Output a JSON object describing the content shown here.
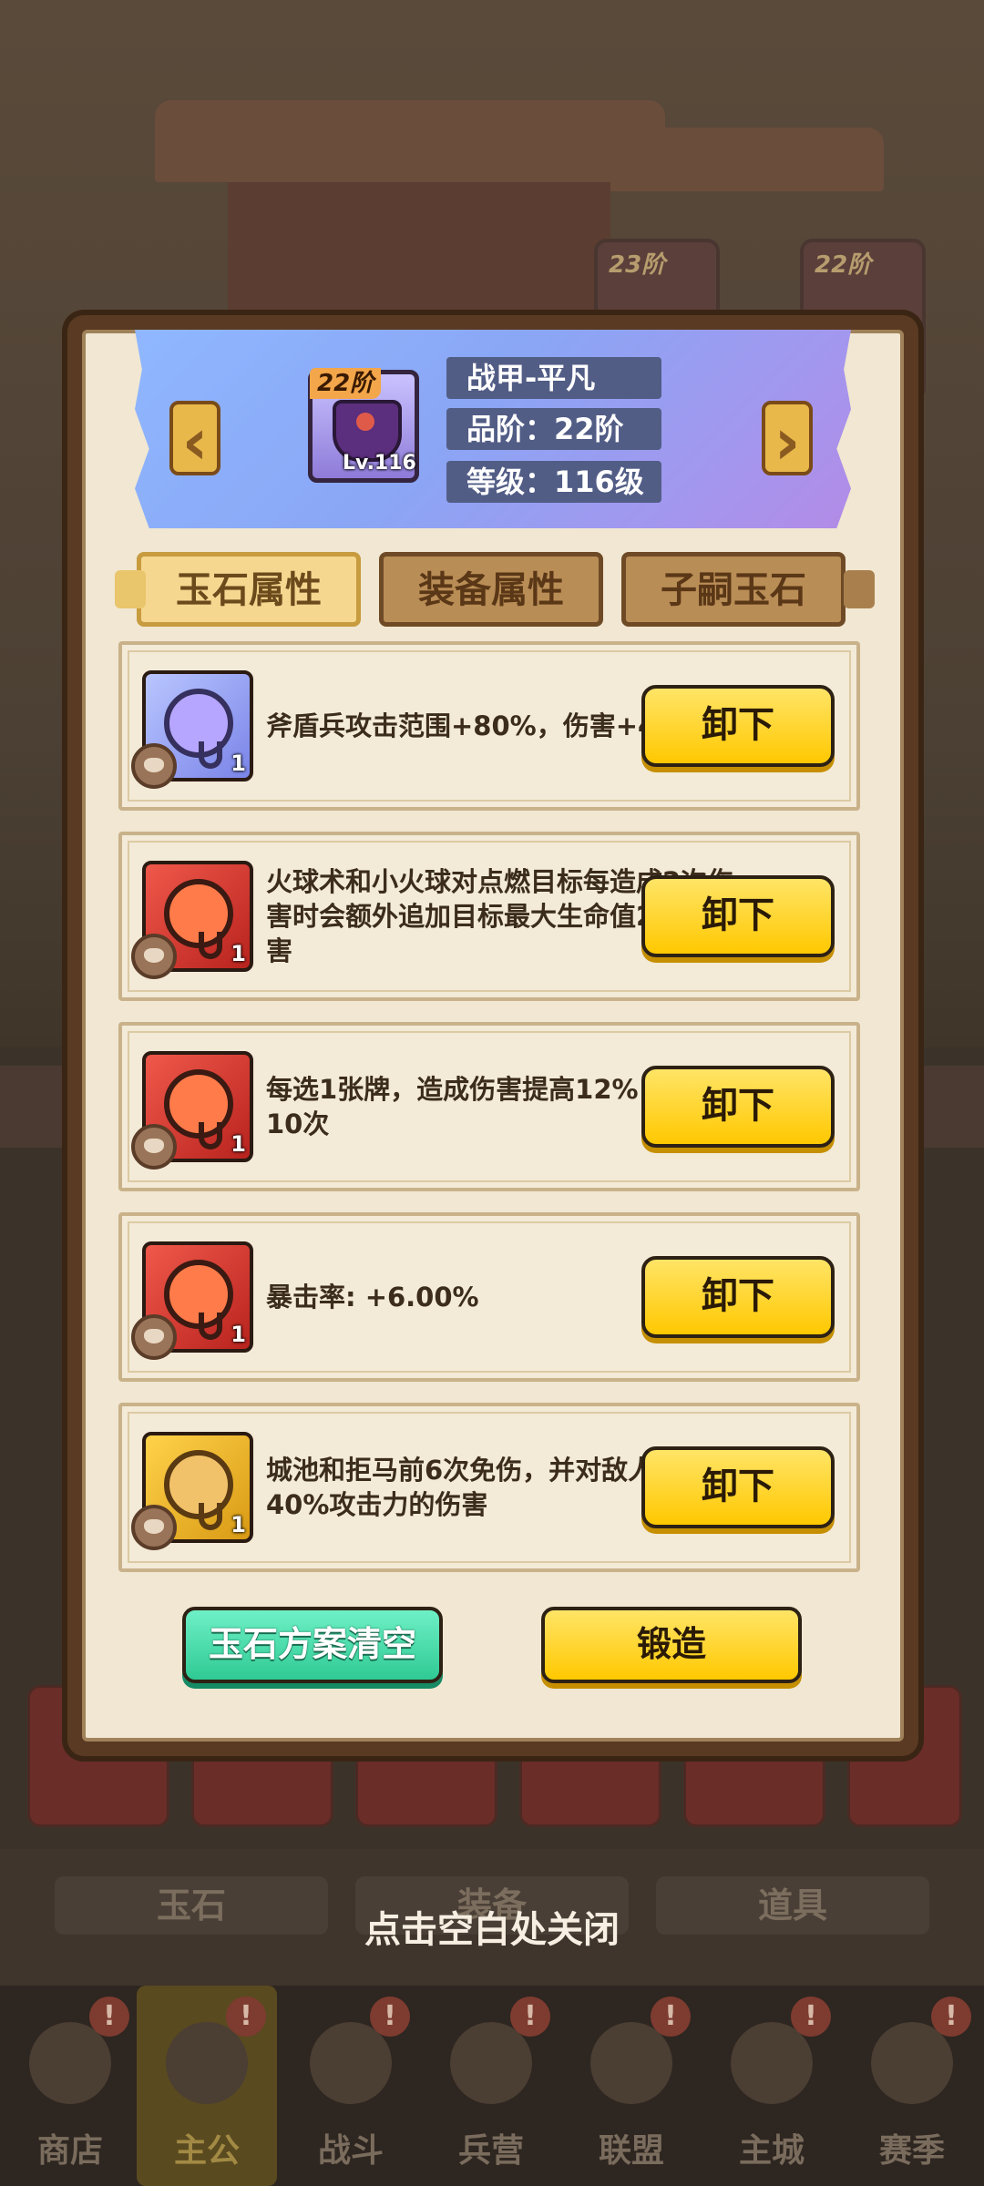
{
  "background": {
    "cards": [
      "23阶",
      "22阶"
    ],
    "tabs": [
      "玉石",
      "装备",
      "道具"
    ],
    "nav": [
      {
        "label": "商店",
        "badge": "!"
      },
      {
        "label": "主公",
        "badge": "!",
        "active": true
      },
      {
        "label": "战斗",
        "badge": "!"
      },
      {
        "label": "兵营",
        "badge": "!"
      },
      {
        "label": "联盟",
        "badge": "!"
      },
      {
        "label": "主城",
        "badge": "!"
      },
      {
        "label": "赛季",
        "badge": "!"
      }
    ]
  },
  "equipment": {
    "tier_badge": "22阶",
    "level_label": "Lv.116",
    "name": "战甲-平凡",
    "grade": "品阶：22阶",
    "level": "等级：116级",
    "prev_label": "‹",
    "next_label": "›"
  },
  "tabs": [
    {
      "label": "玉石属性",
      "selected": true
    },
    {
      "label": "装备属性",
      "selected": false
    },
    {
      "label": "子嗣玉石",
      "selected": false
    }
  ],
  "gems": [
    {
      "color": "blue",
      "count": "1",
      "text": "斧盾兵攻击范围+80%，伤害+45%",
      "button": "卸下"
    },
    {
      "color": "red",
      "count": "1",
      "text": "火球术和小火球对点燃目标每造成2次伤害时会额外追加目标最大生命值2%的伤害",
      "button": "卸下"
    },
    {
      "color": "red",
      "count": "1",
      "text": "每选1张牌，造成伤害提高12%，最多10次",
      "button": "卸下"
    },
    {
      "color": "red",
      "count": "1",
      "text": "暴击率: +6.00%",
      "button": "卸下"
    },
    {
      "color": "gold",
      "count": "1",
      "text": "城池和拒马前6次免伤，并对敌人造成40%攻击力的伤害",
      "button": "卸下"
    }
  ],
  "actions": {
    "clear_label": "玉石方案清空",
    "forge_label": "锻造"
  },
  "close_hint": "点击空白处关闭",
  "colors": {
    "accent_yellow": "#ffc800",
    "accent_green": "#2fca94",
    "panel_frame": "#5a3a22",
    "banner_blue": "#8fb7ff"
  }
}
